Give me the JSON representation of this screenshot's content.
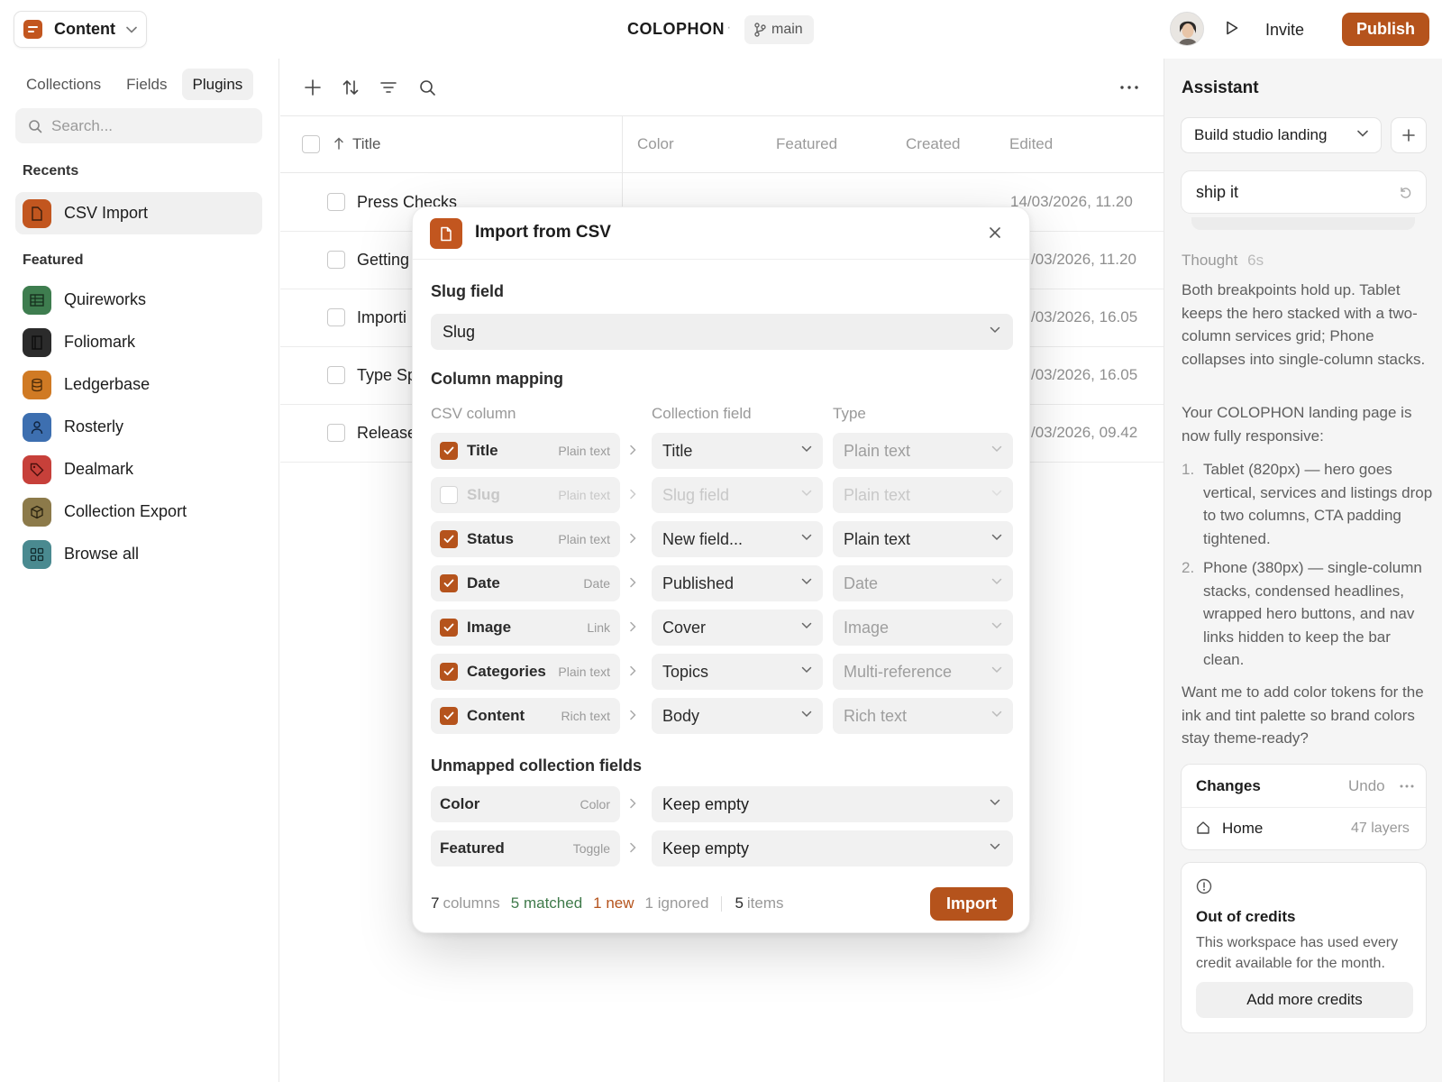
{
  "topbar": {
    "workspace_label": "Content",
    "project_name": "COLOPHON",
    "separator": "·",
    "branch": "main",
    "invite_label": "Invite",
    "publish_label": "Publish",
    "accent_color": "#b5531c"
  },
  "sidebar": {
    "tabs": [
      "Collections",
      "Fields",
      "Plugins"
    ],
    "active_tab": "Plugins",
    "search_placeholder": "Search...",
    "recents_heading": "Recents",
    "recents": [
      {
        "label": "CSV Import",
        "icon": "document-icon",
        "color": "#c2561f"
      }
    ],
    "featured_heading": "Featured",
    "featured": [
      {
        "label": "Quireworks",
        "icon": "table-icon",
        "color": "#3e7d4f"
      },
      {
        "label": "Foliomark",
        "icon": "book-icon",
        "color": "#2b2b2b"
      },
      {
        "label": "Ledgerbase",
        "icon": "database-icon",
        "color": "#d07a24"
      },
      {
        "label": "Rosterly",
        "icon": "person-icon",
        "color": "#3d6fb0"
      },
      {
        "label": "Dealmark",
        "icon": "tag-icon",
        "color": "#c7403a"
      },
      {
        "label": "Collection Export",
        "icon": "box-icon",
        "color": "#8c7a4a"
      },
      {
        "label": "Browse all",
        "icon": "grid-icon",
        "color": "#4a8a90"
      }
    ]
  },
  "table": {
    "columns": [
      "Title",
      "Color",
      "Featured",
      "Created",
      "Edited"
    ],
    "rows": [
      {
        "title": "Press Checks",
        "edited": "14/03/2026, 11.20"
      },
      {
        "title": "Getting",
        "edited": "/03/2026, 11.20"
      },
      {
        "title": "Importi",
        "edited": "/03/2026, 16.05"
      },
      {
        "title": "Type Sp",
        "edited": "/03/2026, 16.05"
      },
      {
        "title": "Release",
        "edited": "/03/2026, 09.42"
      }
    ]
  },
  "modal": {
    "title": "Import from CSV",
    "slug_heading": "Slug field",
    "slug_value": "Slug",
    "mapping_heading": "Column mapping",
    "col_headers": {
      "csv": "CSV column",
      "field": "Collection field",
      "type": "Type"
    },
    "mappings": [
      {
        "name": "Title",
        "csv_type": "Plain text",
        "checked": true,
        "field": "Title",
        "type": "Plain text",
        "type_active": false
      },
      {
        "name": "Slug",
        "csv_type": "Plain text",
        "checked": false,
        "field": "Slug field",
        "type": "Plain text",
        "type_active": false
      },
      {
        "name": "Status",
        "csv_type": "Plain text",
        "checked": true,
        "field": "New field...",
        "type": "Plain text",
        "type_active": true
      },
      {
        "name": "Date",
        "csv_type": "Date",
        "checked": true,
        "field": "Published",
        "type": "Date",
        "type_active": false
      },
      {
        "name": "Image",
        "csv_type": "Link",
        "checked": true,
        "field": "Cover",
        "type": "Image",
        "type_active": false
      },
      {
        "name": "Categories",
        "csv_type": "Plain text",
        "checked": true,
        "field": "Topics",
        "type": "Multi-reference",
        "type_active": false
      },
      {
        "name": "Content",
        "csv_type": "Rich text",
        "checked": true,
        "field": "Body",
        "type": "Rich text",
        "type_active": false
      }
    ],
    "unmapped_heading": "Unmapped collection fields",
    "unmapped": [
      {
        "name": "Color",
        "type": "Color",
        "value": "Keep empty"
      },
      {
        "name": "Featured",
        "type": "Toggle",
        "value": "Keep empty"
      }
    ],
    "footer": {
      "columns_num": "7",
      "columns_label": "columns",
      "matched": "5 matched",
      "new": "1 new",
      "ignored": "1 ignored",
      "items_num": "5",
      "items_label": "items"
    },
    "import_label": "Import"
  },
  "assistant": {
    "title": "Assistant",
    "thread": "Build studio landing",
    "prompt": "ship it",
    "thought_label": "Thought",
    "thought_time": "6s",
    "para1": "Both breakpoints hold up. Tablet keeps the hero stacked with a two-column services grid; Phone collapses into single-column stacks.",
    "para2": "Your COLOPHON landing page is now fully responsive:",
    "list": [
      {
        "num": "1.",
        "text": "Tablet (820px) — hero goes vertical, services and listings drop to two columns, CTA padding tightened."
      },
      {
        "num": "2.",
        "text": "Phone (380px) — single-column stacks, condensed headlines, wrapped hero buttons, and nav links hidden to keep the bar clean."
      }
    ],
    "para3": "Want me to add color tokens for the ink and tint palette so brand colors stay theme-ready?",
    "changes": {
      "title": "Changes",
      "undo": "Undo",
      "item": "Home",
      "count": "47 layers"
    },
    "credits": {
      "title": "Out of credits",
      "desc": "This workspace has used every credit available for the month.",
      "button": "Add more credits"
    }
  }
}
